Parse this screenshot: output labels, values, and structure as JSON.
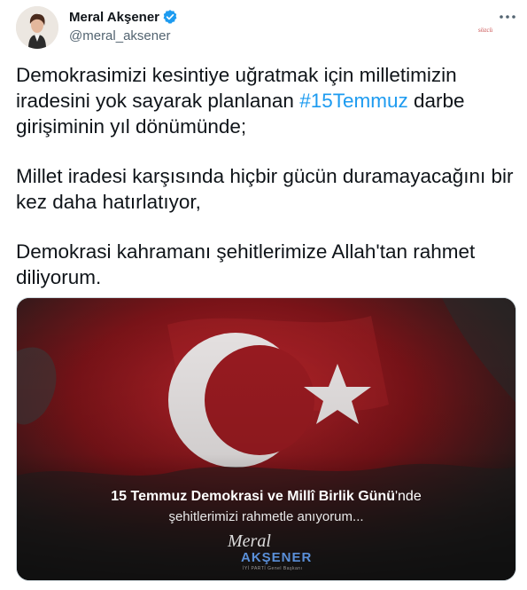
{
  "author": {
    "display_name": "Meral Akşener",
    "handle": "@meral_aksener"
  },
  "icons": {
    "verified": "verified-badge-icon",
    "more": "more-options-icon"
  },
  "colors": {
    "link": "#1d9bf0",
    "verified": "#1d9bf0",
    "handle": "#536471",
    "flag_red": "#a3151c"
  },
  "watermark": "sözcü",
  "tweet": {
    "line1_text": "Demokrasimizi kesintiye uğratmak için milletimizin iradesini yok sayarak planlanan ",
    "hashtag": "#15Temmuz",
    "line1_tail": " darbe girişiminin yıl dönümünde;",
    "paragraph2": "Millet iradesi karşısında hiçbir gücün duramayacağını bir kez daha hatırlatıyor,",
    "paragraph3": "Demokrasi kahramanı şehitlerimize Allah'tan rahmet diliyorum."
  },
  "media": {
    "caption_bold": "15 Temmuz Demokrasi ve Millî Birlik Günü",
    "caption_suffix": "'nde",
    "caption_line2": "şehitlerimizi rahmetle anıyorum...",
    "signature_script": "Meral",
    "signature_surname": "AKŞENER",
    "signature_sub": "İYİ PARTİ Genel Başkanı"
  }
}
